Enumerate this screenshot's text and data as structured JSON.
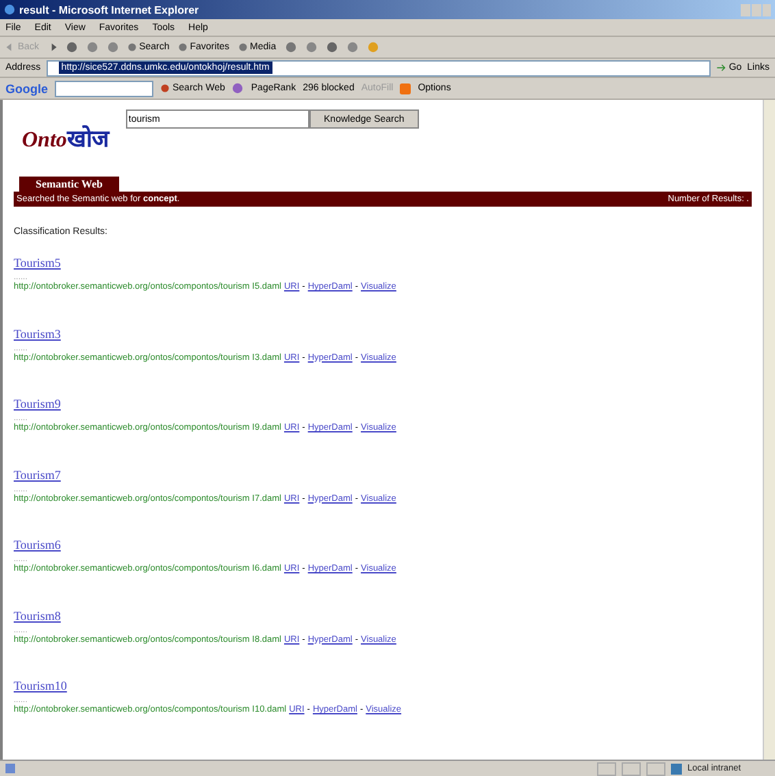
{
  "window": {
    "title": "result - Microsoft Internet Explorer"
  },
  "menu": [
    "File",
    "Edit",
    "View",
    "Favorites",
    "Tools",
    "Help"
  ],
  "toolbar": {
    "back": "Back",
    "buttons": [
      "Search",
      "Favorites",
      "Media"
    ]
  },
  "address": {
    "label": "Address",
    "url": "http://sice527.ddns.umkc.edu/ontokhoj/result.htm",
    "go": "Go",
    "links": "Links"
  },
  "google_bar": {
    "brand": "Google",
    "search_web": "Search Web",
    "pagerank": "PageRank",
    "blocked": "296 blocked",
    "autofill": "AutoFill",
    "options": "Options"
  },
  "page": {
    "logo_latin": "Onto",
    "logo_script": "खोज",
    "search_value": "tourism",
    "search_button": "Knowledge Search",
    "tab": "Semantic Web",
    "searched": "Searched the Semantic web for **concept**.",
    "results_count": "Number of Results: .",
    "heading": "Classification Results:",
    "separator": "-",
    "results": [
      {
        "title": "Tourism5",
        "snippet": "......",
        "url": "http://ontobroker.semanticweb.org/ontos/compontos/tourism I5.daml",
        "links": [
          "URI",
          "HyperDaml",
          "Visualize"
        ]
      },
      {
        "title": "Tourism3",
        "snippet": "......",
        "url": "http://ontobroker.semanticweb.org/ontos/compontos/tourism I3.daml",
        "links": [
          "URI",
          "HyperDaml",
          "Visualize"
        ]
      },
      {
        "title": "Tourism9",
        "snippet": "......",
        "url": "http://ontobroker.semanticweb.org/ontos/compontos/tourism I9.daml",
        "links": [
          "URI",
          "HyperDaml",
          "Visualize"
        ]
      },
      {
        "title": "Tourism7",
        "snippet": "......",
        "url": "http://ontobroker.semanticweb.org/ontos/compontos/tourism I7.daml",
        "links": [
          "URI",
          "HyperDaml",
          "Visualize"
        ]
      },
      {
        "title": "Tourism6",
        "snippet": "......",
        "url": "http://ontobroker.semanticweb.org/ontos/compontos/tourism I6.daml",
        "links": [
          "URI",
          "HyperDaml",
          "Visualize"
        ]
      },
      {
        "title": "Tourism8",
        "snippet": "......",
        "url": "http://ontobroker.semanticweb.org/ontos/compontos/tourism I8.daml",
        "links": [
          "URI",
          "HyperDaml",
          "Visualize"
        ]
      },
      {
        "title": "Tourism10",
        "snippet": "......",
        "url": "http://ontobroker.semanticweb.org/ontos/compontos/tourism I10.daml",
        "links": [
          "URI",
          "HyperDaml",
          "Visualize"
        ]
      }
    ]
  },
  "status_bar": {
    "zone": "Local intranet"
  }
}
